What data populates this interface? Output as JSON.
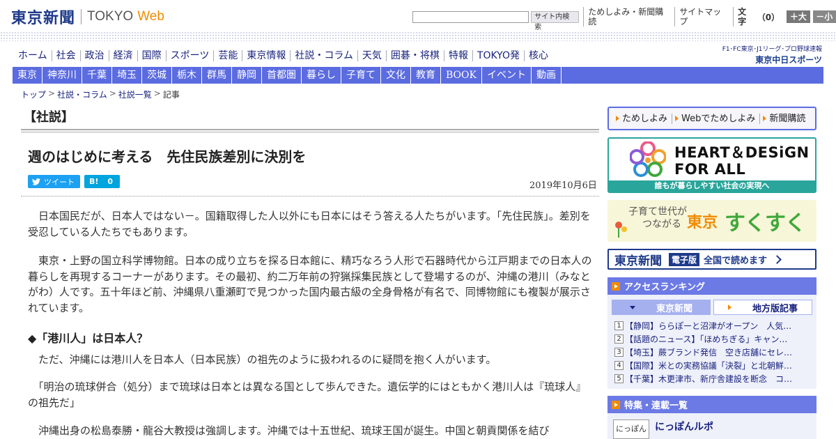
{
  "header": {
    "logo_jp": "東京新聞",
    "logo_tokyo": "TOKYO",
    "logo_web": "Web",
    "search_button": "サイト内検索",
    "links": [
      "ためしよみ・新聞購読",
      "サイトマップ"
    ],
    "font_size_label": "文字",
    "font_size_value": "（0）",
    "font_bigger": "＋大",
    "font_smaller": "－小"
  },
  "main_nav": [
    "ホーム",
    "社会",
    "政治",
    "経済",
    "国際",
    "スポーツ",
    "芸能",
    "東京情報",
    "社説・コラム",
    "天気",
    "囲碁・将棋",
    "特報",
    "TOKYO発",
    "核心"
  ],
  "chunichi_sports": {
    "line1": "F1･FC東京･J1リーグ･プロ野球速報",
    "line2": "東京中日スポーツ"
  },
  "region_nav": [
    "東京",
    "神奈川",
    "千葉",
    "埼玉",
    "茨城",
    "栃木",
    "群馬",
    "静岡",
    "首都圏",
    "暮らし",
    "子育て",
    "文化",
    "教育",
    "BOOK",
    "イベント",
    "動画"
  ],
  "breadcrumb": [
    "トップ",
    "社説・コラム",
    "社説一覧",
    "記事"
  ],
  "article": {
    "section": "【社説】",
    "headline": "週のはじめに考える　先住民族差別に決別を",
    "tweet_label": "ツイート",
    "hatena_label": "B!",
    "hatena_count": "0",
    "date": "2019年10月6日",
    "paragraphs": [
      "　日本国民だが、日本人ではない－。国籍取得した人以外にも日本にはそう答える人たちがいます。「先住民族」。差別を受忍している人たちでもあります。",
      "　東京・上野の国立科学博物館。日本の成り立ちを探る日本館に、精巧なろう人形で石器時代から江戸期までの日本人の暮らしを再現するコーナーがあります。その最初、約二万年前の狩猟採集民族として登場するのが、沖縄の港川（みなとがわ）人です。五十年ほど前、沖縄県八重瀬町で見つかった国内最古級の全身骨格が有名で、同博物館にも複製が展示されています。"
    ],
    "subhead": "◆「港川人」は日本人？",
    "paragraphs_after": [
      "　ただ、沖縄には港川人を日本人（日本民族）の祖先のように扱われるのに疑問を抱く人がいます。",
      "　「明治の琉球併合（処分）まで琉球は日本とは異なる国として歩んできた。遺伝学的にはともかく港川人は『琉球人』の祖先だ」",
      "　沖縄出身の松島泰勝・龍谷大教授は強調します。沖縄では十五世紀、琉球王国が誕生。中国と朝貢関係を結び"
    ]
  },
  "sidebar": {
    "links": [
      "ためしよみ",
      "Webでためしよみ",
      "新聞購読"
    ],
    "heart_title_1": "HEART＆DESiGN",
    "heart_title_2": "FOR ALL",
    "heart_foot": "誰もが暮らしやすい社会の実現へ",
    "suku_small_1": "子育て世代が",
    "suku_small_2": "つながる",
    "suku_tokyo": "東京",
    "suku_big": "すくすく",
    "denshi_logo": "東京新聞",
    "denshi_badge": "電子版",
    "denshi_text": "全国で読めます",
    "ranking_title": "アクセスランキング",
    "ranking_tabs": [
      "東京新聞",
      "地方版記事"
    ],
    "ranking_items": [
      {
        "num": "1",
        "text": "【静岡】ららぽーと沼津がオープン　人気…"
      },
      {
        "num": "2",
        "text": "【話題のニュース】「ほめちぎる」キャン…"
      },
      {
        "num": "3",
        "text": "【埼玉】蕨ブランド発信　空き店舗にセレ…"
      },
      {
        "num": "4",
        "text": "【国際】米との実務協議「決裂」と北朝鮮…"
      },
      {
        "num": "5",
        "text": "【千葉】木更津市、新庁舎建設を断念　コ…"
      }
    ],
    "feature_title": "特集・連載一覧",
    "nippon_thumb": "にっぽん",
    "nippon_label": "にっぽんルポ"
  },
  "colors": {
    "brand_navy": "#1e3a8a",
    "nav_blue": "#5b6be0",
    "accent_orange": "#f08c00",
    "twitter": "#1da1f2",
    "hatena": "#00a4de",
    "teal": "#2aa59b"
  }
}
